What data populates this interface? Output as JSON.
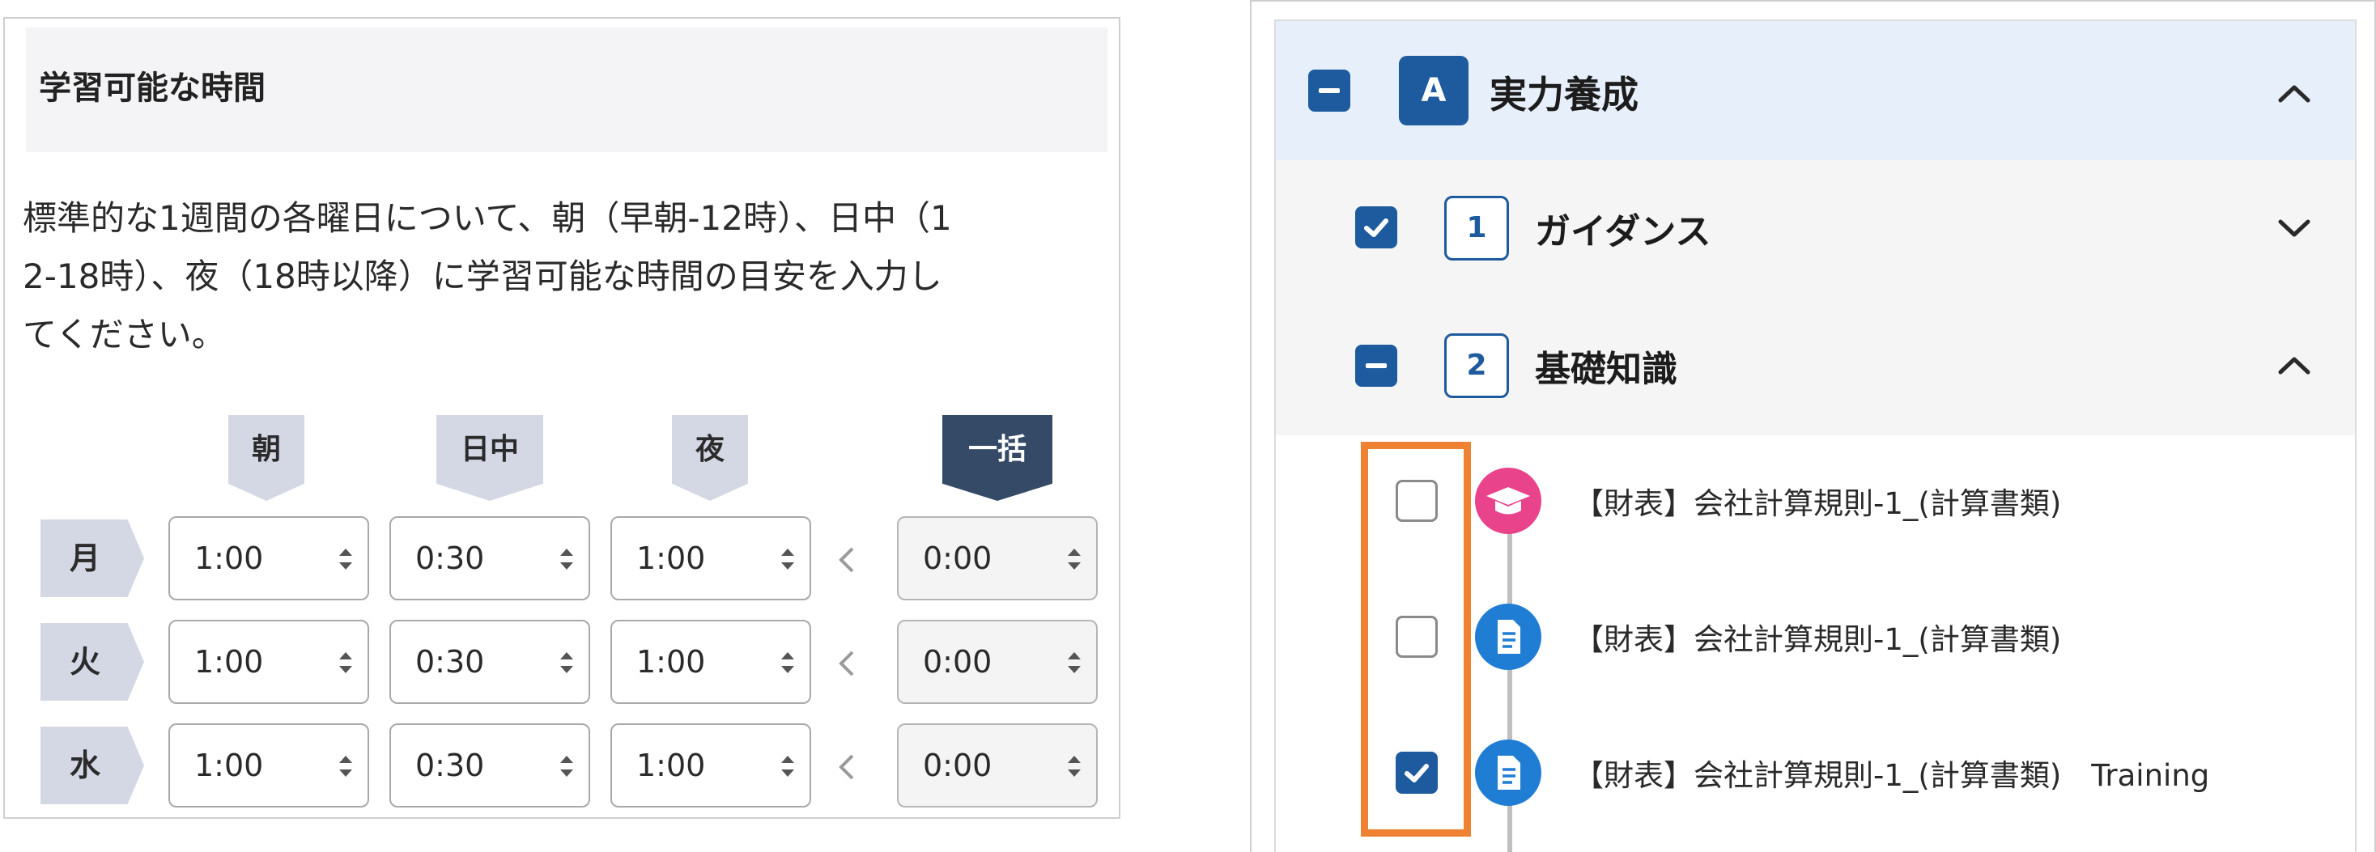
{
  "availability": {
    "title": "学習可能な時間",
    "description_lines": [
      "標準的な1週間の各曜日について、朝（早朝-12時）、日中（1",
      "2-18時）、夜（18時以降）に学習可能な時間の目安を入力し",
      "てください。"
    ],
    "columns": [
      "朝",
      "日中",
      "夜"
    ],
    "bulk_column": "一括",
    "rows": [
      {
        "day": "月",
        "morning": "1:00",
        "daytime": "0:30",
        "night": "1:00",
        "bulk": "0:00"
      },
      {
        "day": "火",
        "morning": "1:00",
        "daytime": "0:30",
        "night": "1:00",
        "bulk": "0:00"
      },
      {
        "day": "水",
        "morning": "1:00",
        "daytime": "0:30",
        "night": "1:00",
        "bulk": "0:00"
      }
    ]
  },
  "curriculum": {
    "section": {
      "badge": "A",
      "title": "実力養成",
      "checkbox": "indeterminate",
      "expanded": true
    },
    "groups": [
      {
        "number": "1",
        "title": "ガイダンス",
        "checkbox": "checked",
        "expanded": false
      },
      {
        "number": "2",
        "title": "基礎知識",
        "checkbox": "indeterminate",
        "expanded": true
      }
    ],
    "items": [
      {
        "label": "【財表】会社計算規則-1_(計算書類)",
        "icon": "graduation-cap-icon",
        "checked": false
      },
      {
        "label": "【財表】会社計算規則-1_(計算書類)",
        "icon": "document-icon",
        "checked": false
      },
      {
        "label": "【財表】会社計算規則-1_(計算書類)　Training",
        "icon": "document-icon",
        "checked": true
      }
    ]
  },
  "colors": {
    "primary_blue": "#1d5a9e",
    "icon_blue": "#1f7ed4",
    "icon_pink": "#e9438b",
    "highlight_orange": "#ef8232",
    "section_bg": "#e6effa",
    "column_head_bg": "#d3d8e4",
    "bulk_head_bg": "#354a67"
  }
}
